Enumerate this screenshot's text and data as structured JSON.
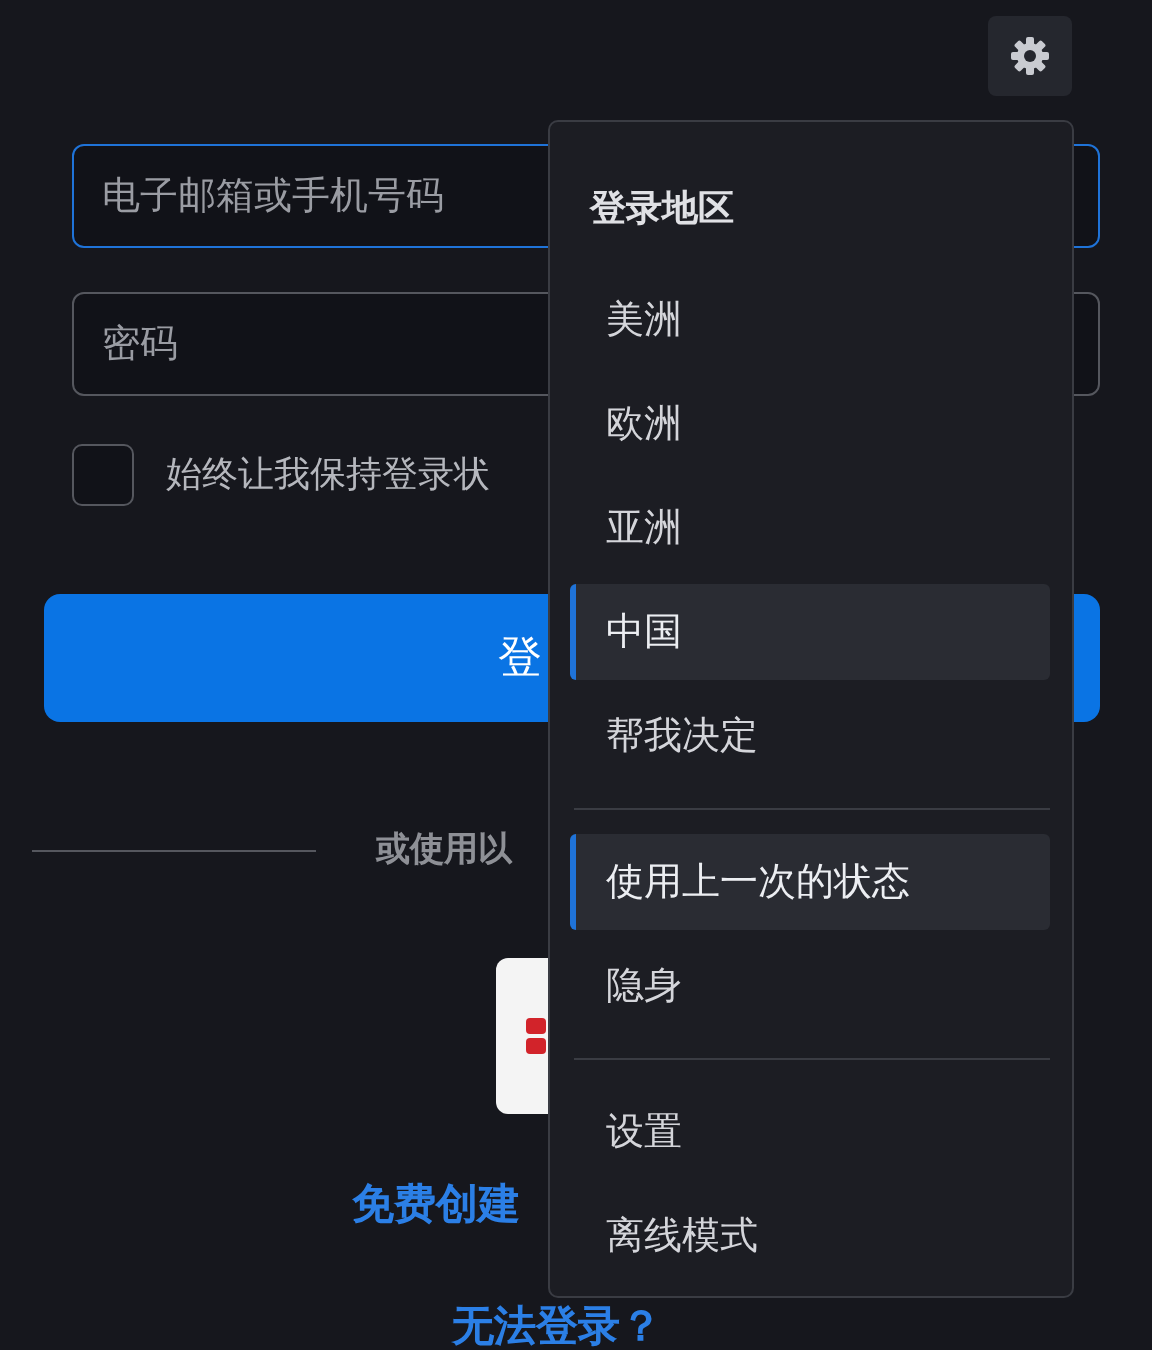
{
  "login_form": {
    "email_field": {
      "placeholder": "电子邮箱或手机号码",
      "focused": true
    },
    "password_field": {
      "placeholder": "密码"
    },
    "remember_me": {
      "label": "始终让我保持登录状",
      "checked": false
    },
    "login_button": "登",
    "divider_text": "或使用以",
    "create_account_link": "免费创建",
    "cant_login_link": "无法登录？"
  },
  "settings_menu": {
    "sections": [
      {
        "header": "登录地区",
        "items": [
          {
            "label": "美洲",
            "selected": false
          },
          {
            "label": "欧洲",
            "selected": false
          },
          {
            "label": "亚洲",
            "selected": false
          },
          {
            "label": "中国",
            "selected": true
          },
          {
            "label": "帮我决定",
            "selected": false
          }
        ]
      },
      {
        "items": [
          {
            "label": "使用上一次的状态",
            "selected": true
          },
          {
            "label": "隐身",
            "selected": false
          }
        ]
      },
      {
        "items": [
          {
            "label": "设置",
            "selected": false
          },
          {
            "label": "离线模式",
            "selected": false
          }
        ]
      }
    ]
  }
}
